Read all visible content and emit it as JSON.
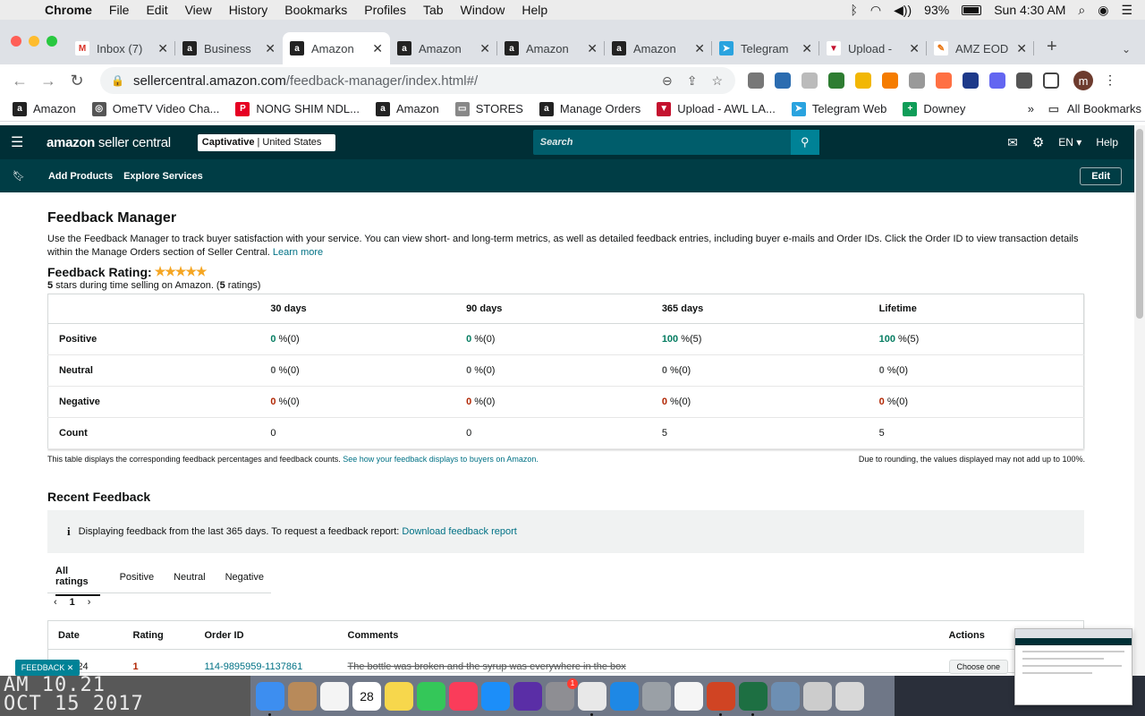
{
  "menubar": {
    "app": "Chrome",
    "items": [
      "File",
      "Edit",
      "View",
      "History",
      "Bookmarks",
      "Profiles",
      "Tab",
      "Window",
      "Help"
    ],
    "battery": "93%",
    "clock": "Sun 4:30 AM"
  },
  "tabs": [
    {
      "label": "Inbox (7)",
      "icon": "gmail-icon",
      "color": "#ffffff",
      "glyph": "M",
      "gcolor": "#d93025"
    },
    {
      "label": "Business",
      "icon": "amazon-icon",
      "color": "#222222",
      "glyph": "a",
      "gcolor": "#ffffff"
    },
    {
      "label": "Amazon",
      "icon": "amazon-icon",
      "color": "#222222",
      "glyph": "a",
      "gcolor": "#ffffff"
    },
    {
      "label": "Amazon",
      "icon": "amazon-icon",
      "color": "#222222",
      "glyph": "a",
      "gcolor": "#ffffff"
    },
    {
      "label": "Amazon",
      "icon": "amazon-icon",
      "color": "#222222",
      "glyph": "a",
      "gcolor": "#ffffff"
    },
    {
      "label": "Amazon",
      "icon": "amazon-icon",
      "color": "#222222",
      "glyph": "a",
      "gcolor": "#ffffff"
    },
    {
      "label": "Telegram",
      "icon": "telegram-icon",
      "color": "#2aa3df",
      "glyph": "➤",
      "gcolor": "#ffffff"
    },
    {
      "label": "Upload -",
      "icon": "upload-icon",
      "color": "#ffffff",
      "glyph": "▼",
      "gcolor": "#c4122f"
    },
    {
      "label": "AMZ EOD",
      "icon": "amz-eod-icon",
      "color": "#ffffff",
      "glyph": "✎",
      "gcolor": "#e8710a"
    }
  ],
  "address": {
    "host": "sellercentral.amazon.com",
    "path": "/feedback-manager/index.html#/"
  },
  "bookmarks": [
    {
      "label": "Amazon",
      "icon": "amazon-icon",
      "color": "#222222",
      "glyph": "a"
    },
    {
      "label": "OmeTV Video Cha...",
      "icon": "globe-icon",
      "color": "#555555",
      "glyph": "◎"
    },
    {
      "label": "NONG SHIM NDL...",
      "icon": "pinterest-icon",
      "color": "#e60023",
      "glyph": "P"
    },
    {
      "label": "Amazon",
      "icon": "amazon-icon",
      "color": "#222222",
      "glyph": "a"
    },
    {
      "label": "STORES",
      "icon": "folder-icon",
      "color": "#888888",
      "glyph": "▭"
    },
    {
      "label": "Manage Orders",
      "icon": "amazon-icon",
      "color": "#222222",
      "glyph": "a"
    },
    {
      "label": "Upload - AWL LA...",
      "icon": "upload-icon",
      "color": "#c4122f",
      "glyph": "▼"
    },
    {
      "label": "Telegram Web",
      "icon": "telegram-icon",
      "color": "#2aa3df",
      "glyph": "➤"
    },
    {
      "label": "Downey",
      "icon": "sheets-icon",
      "color": "#0f9d58",
      "glyph": "+"
    }
  ],
  "all_bookmarks": "All Bookmarks",
  "sc": {
    "logo": "amazon",
    "logo2": " seller central",
    "account_bold": "Captivative",
    "account_rest": "| United States",
    "search_placeholder": "Search",
    "lang": "EN",
    "help": "Help",
    "subnav": [
      "Add Products",
      "Explore Services"
    ],
    "edit": "Edit"
  },
  "page": {
    "title": "Feedback Manager",
    "desc": "Use the Feedback Manager to track buyer satisfaction with your service. You can view short- and long-term metrics, as well as detailed feedback entries, including buyer e-mails and Order IDs. Click the Order ID to view transaction details within the Manage Orders section of Seller Central.",
    "learn_more": "Learn more",
    "rating_label": "Feedback Rating:",
    "stars": "★★★★★",
    "stars_value": 5,
    "rating_stars_num": "5",
    "rating_sub1": " stars during time selling on Amazon. (",
    "rating_count": "5",
    "rating_sub2": " ratings)"
  },
  "fb_table": {
    "headers": [
      "",
      "30 days",
      "90 days",
      "365 days",
      "Lifetime"
    ],
    "rows": [
      {
        "label": "Positive",
        "cells": [
          {
            "v": "0",
            "s": " %(0)",
            "c": "g"
          },
          {
            "v": "0",
            "s": " %(0)",
            "c": "g"
          },
          {
            "v": "100",
            "s": " %(5)",
            "c": "g"
          },
          {
            "v": "100",
            "s": " %(5)",
            "c": "g"
          }
        ]
      },
      {
        "label": "Neutral",
        "cells": [
          {
            "v": "0",
            "s": " %(0)",
            "c": "gray"
          },
          {
            "v": "0",
            "s": " %(0)",
            "c": "gray"
          },
          {
            "v": "0",
            "s": " %(0)",
            "c": "gray"
          },
          {
            "v": "0",
            "s": " %(0)",
            "c": "gray"
          }
        ]
      },
      {
        "label": "Negative",
        "cells": [
          {
            "v": "0",
            "s": " %(0)",
            "c": "r"
          },
          {
            "v": "0",
            "s": " %(0)",
            "c": "r"
          },
          {
            "v": "0",
            "s": " %(0)",
            "c": "r"
          },
          {
            "v": "0",
            "s": " %(0)",
            "c": "r"
          }
        ]
      },
      {
        "label": "Count",
        "cells": [
          {
            "v": "",
            "s": "0",
            "c": ""
          },
          {
            "v": "",
            "s": "0",
            "c": ""
          },
          {
            "v": "",
            "s": "5",
            "c": ""
          },
          {
            "v": "",
            "s": "5",
            "c": ""
          }
        ]
      }
    ],
    "note_left": "This table displays the corresponding feedback percentages and feedback counts.",
    "note_link": "See how your feedback displays to buyers on Amazon.",
    "note_right": "Due to rounding, the values displayed may not add up to 100%."
  },
  "recent": {
    "title": "Recent Feedback",
    "info": "Displaying feedback from the last 365 days. To request a feedback report:",
    "info_link": "Download feedback report",
    "filters": [
      "All ratings",
      "Positive",
      "Neutral",
      "Negative"
    ],
    "page": "1",
    "headers": [
      "Date",
      "Rating",
      "Order ID",
      "Comments",
      "Actions"
    ],
    "row": {
      "date": "7/2024",
      "rating": "1",
      "order": "114-9895959-1137861",
      "comment": "The bottle was broken and the syrup was everywhere in the box",
      "action": "Choose one"
    }
  },
  "feedback_pill": "FEEDBACK ✕",
  "wall_clock": [
    "AM 10.21",
    "OCT 15 2017"
  ],
  "dock": [
    {
      "icon": "finder-icon",
      "color": "#3d8ef0"
    },
    {
      "icon": "contacts-icon",
      "color": "#b88a5a"
    },
    {
      "icon": "reminders-icon",
      "color": "#f4f4f4"
    },
    {
      "icon": "calendar-icon",
      "color": "#ffffff"
    },
    {
      "icon": "notes-icon",
      "color": "#f7d74c"
    },
    {
      "icon": "facetime-icon",
      "color": "#34c759"
    },
    {
      "icon": "music-icon",
      "color": "#fa3c5a"
    },
    {
      "icon": "appstore-icon",
      "color": "#1c8ef9"
    },
    {
      "icon": "siri-icon",
      "color": "#5a2ea6"
    },
    {
      "icon": "settings-icon",
      "color": "#8e8e93"
    },
    {
      "icon": "chrome-icon",
      "color": "#e8e8e8"
    },
    {
      "icon": "safari-icon",
      "color": "#1e88e5"
    },
    {
      "icon": "launchpad-icon",
      "color": "#9aa0a6"
    },
    {
      "icon": "photos-icon",
      "color": "#f5f5f5"
    },
    {
      "icon": "powerpoint-icon",
      "color": "#d04423"
    },
    {
      "icon": "excel-icon",
      "color": "#1d6f42"
    },
    {
      "icon": "preview-icon",
      "color": "#6d8fb3"
    },
    {
      "icon": "downloads-icon",
      "color": "#cccccc"
    },
    {
      "icon": "trash-icon",
      "color": "#d8d8d8"
    }
  ],
  "calendar_day": "28",
  "settings_badge": "1"
}
